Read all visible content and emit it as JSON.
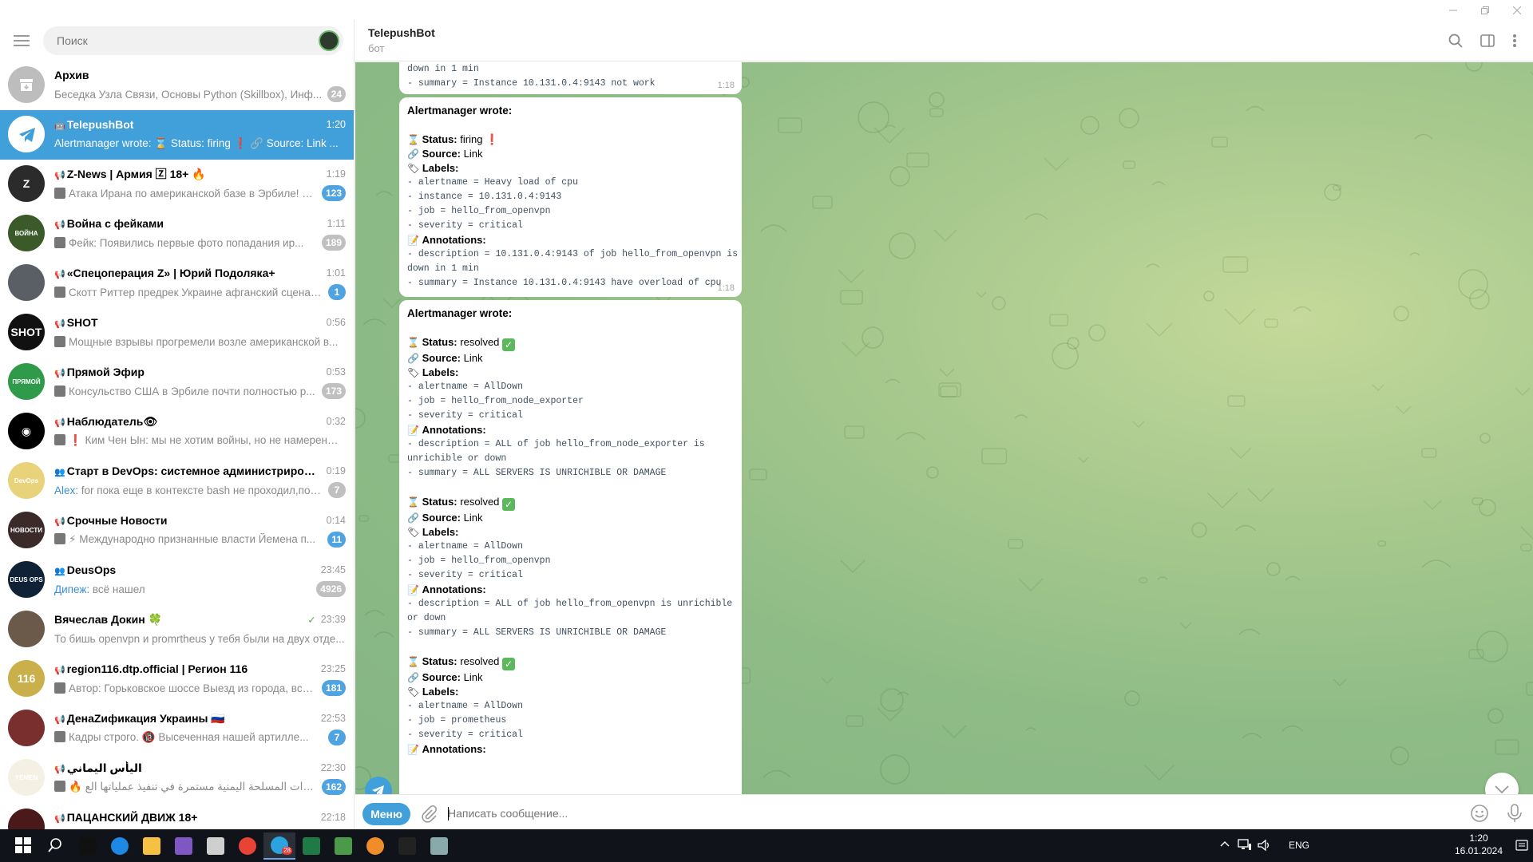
{
  "window": {
    "controls": [
      "minimize",
      "restore",
      "close"
    ]
  },
  "sidebar": {
    "search_placeholder": "Поиск",
    "chats": [
      {
        "title": "Архив",
        "preview": "Беседка Узла Связи, Основы Python (Skillbox), Инф...",
        "time": "",
        "badge": "24",
        "muted": true,
        "avatar_color": "#bdbdbd",
        "avatar_text": ""
      },
      {
        "title": "TelepushBot",
        "preview": "Alertmanager wrote: ⌛ Status: firing ❗ 🔗 Source: Link ...",
        "time": "1:20",
        "badge": "",
        "muted": false,
        "avatar_color": "#ffffff",
        "avatar_text": ""
      },
      {
        "title": "Z-News | Армия 🅉 18+ 🔥",
        "preview": "Атака Ирана по американской базе в Эрбиле! С...",
        "time": "1:19",
        "badge": "123",
        "muted": false,
        "avatar_color": "#2b2b2b",
        "avatar_text": "Z"
      },
      {
        "title": "Война с фейками",
        "preview": "Фейк: Появились первые фото попадания ир...",
        "time": "1:11",
        "badge": "189",
        "muted": true,
        "avatar_color": "#3a5a2a",
        "avatar_text": "ВОЙНА"
      },
      {
        "title": "«Спецоперация Z» | Юрий Подоляка+",
        "preview": "Скотт Риттер предрек Украине афганский сценар...",
        "time": "1:01",
        "badge": "1",
        "muted": false,
        "avatar_color": "#5a5f66",
        "avatar_text": ""
      },
      {
        "title": "SHOT",
        "preview": "Мощные взрывы прогремели возле американской в...",
        "time": "0:56",
        "badge": "",
        "muted": false,
        "avatar_color": "#111111",
        "avatar_text": "SHOT"
      },
      {
        "title": "Прямой Эфир",
        "preview": "Консульство США в Эрбиле почти полностью р...",
        "time": "0:53",
        "badge": "173",
        "muted": true,
        "avatar_color": "#2f9a4a",
        "avatar_text": "ПРЯМОЙ"
      },
      {
        "title": "Наблюдатель👁",
        "preview": "❗ Ким Чен Ын: мы не хотим войны, но не намерены ...",
        "time": "0:32",
        "badge": "",
        "muted": false,
        "avatar_color": "#000000",
        "avatar_text": "◉"
      },
      {
        "title": "Старт в DevOps: системное администрирован...",
        "preview": "for пока еще в контексте bash не проходил,пом...",
        "sender": "Alex:",
        "time": "0:19",
        "badge": "7",
        "muted": true,
        "avatar_color": "#e8d27a",
        "avatar_text": "DevOps"
      },
      {
        "title": "Срочные Новости",
        "preview": "⚡ Международно признанные власти Йемена п...",
        "time": "0:14",
        "badge": "11",
        "muted": false,
        "avatar_color": "#3b2a2a",
        "avatar_text": "НОВОСТИ"
      },
      {
        "title": "DeusOps",
        "preview": "всё нашел",
        "sender": "Дипеж:",
        "time": "23:45",
        "badge": "4926",
        "muted": true,
        "avatar_color": "#0f2236",
        "avatar_text": "DEUS OPS"
      },
      {
        "title": "Вячеслав Докин 🍀",
        "preview": "То бишь openvpn и promrtheus у тебя были на двух отде...",
        "time": "23:39",
        "badge": "",
        "muted": false,
        "read": "✓",
        "avatar_color": "#6b5a4a",
        "avatar_text": ""
      },
      {
        "title": "region116.dtp.official | Регион 116",
        "preview": "Автор: Горьковское шоссе  Выезд из города, все...",
        "time": "23:25",
        "badge": "181",
        "muted": false,
        "avatar_color": "#c9b04a",
        "avatar_text": "116"
      },
      {
        "title": "ДенаZификация Украины 🇷🇺",
        "preview": "Кадры строго. 🔞 Высеченная нашей артилле...",
        "time": "22:53",
        "badge": "7",
        "muted": false,
        "avatar_color": "#7a2f2f",
        "avatar_text": ""
      },
      {
        "title": "اليأس اليماني",
        "preview": "🔥 القوات المسلحة اليمنية مستمرة في تنفيذ عملياتها الع...",
        "time": "22:30",
        "badge": "162",
        "muted": false,
        "avatar_color": "#f4f0e4",
        "avatar_text": "YEMEN"
      },
      {
        "title": "ПАЦАНСКИЙ ДВИЖ 18+",
        "preview": "",
        "time": "22:18",
        "badge": "",
        "muted": false,
        "avatar_color": "#4a1a1a",
        "avatar_text": ""
      }
    ]
  },
  "chat": {
    "title": "TelepushBot",
    "status": "бот",
    "composer": {
      "menu_label": "Меню",
      "placeholder": "Написать сообщение..."
    },
    "messages": [
      {
        "time": "1:18",
        "lines_top": [
          {
            "text": "down in 1 min",
            "kind": "cont"
          },
          {
            "key": "summary",
            "value": "Instance 10.131.0.4:9143 not work"
          }
        ]
      },
      {
        "time": "1:18",
        "header": "Alertmanager wrote:",
        "blocks": [
          {
            "status_label": "Status:",
            "status_value": "firing",
            "status_mark": "❗",
            "source_label": "Source:",
            "source_value": "Link",
            "labels_label": "Labels:",
            "labels": [
              {
                "key": "alertname",
                "value": "Heavy load of cpu"
              },
              {
                "key": "instance",
                "value": "10.131.0.4:9143"
              },
              {
                "key": "job",
                "value": "hello_from_openvpn"
              },
              {
                "key": "severity",
                "value": "critical"
              }
            ],
            "annotations_label": "Annotations:",
            "annotations": [
              {
                "key": "description",
                "value": "10.131.0.4:9143 of job hello_from_openvpn is",
                "cont": "down in 1 min"
              },
              {
                "key": "summary",
                "value": "Instance 10.131.0.4:9143  have overload of cpu"
              }
            ]
          }
        ]
      },
      {
        "time": "",
        "header": "Alertmanager wrote:",
        "blocks": [
          {
            "status_label": "Status:",
            "status_value": "resolved",
            "status_mark": "✓",
            "source_label": "Source:",
            "source_value": "Link",
            "labels_label": "Labels:",
            "labels": [
              {
                "key": "alertname",
                "value": "AllDown"
              },
              {
                "key": "job",
                "value": "hello_from_node_exporter"
              },
              {
                "key": "severity",
                "value": "critical"
              }
            ],
            "annotations_label": "Annotations:",
            "annotations": [
              {
                "key": "description",
                "value": "ALL  of job hello_from_node_exporter is",
                "cont": "unrichible or down"
              },
              {
                "key": "summary",
                "value": "ALL SERVERS IS UNRICHIBLE OR DAMAGE"
              }
            ]
          },
          {
            "status_label": "Status:",
            "status_value": "resolved",
            "status_mark": "✓",
            "source_label": "Source:",
            "source_value": "Link",
            "labels_label": "Labels:",
            "labels": [
              {
                "key": "alertname",
                "value": "AllDown"
              },
              {
                "key": "job",
                "value": "hello_from_openvpn"
              },
              {
                "key": "severity",
                "value": "critical"
              }
            ],
            "annotations_label": "Annotations:",
            "annotations": [
              {
                "key": "description",
                "value": "ALL  of job hello_from_openvpn is unrichible",
                "cont": "or down"
              },
              {
                "key": "summary",
                "value": "ALL SERVERS IS UNRICHIBLE OR DAMAGE"
              }
            ]
          },
          {
            "status_label": "Status:",
            "status_value": "resolved",
            "status_mark": "✓",
            "source_label": "Source:",
            "source_value": "Link",
            "labels_label": "Labels:",
            "labels": [
              {
                "key": "alertname",
                "value": "AllDown"
              },
              {
                "key": "job",
                "value": "prometheus"
              },
              {
                "key": "severity",
                "value": "critical"
              }
            ],
            "annotations_label": "Annotations:",
            "annotations": []
          }
        ]
      }
    ]
  },
  "taskbar": {
    "apps": [
      "windows-start",
      "search",
      "tiktok",
      "edge",
      "file-explorer",
      "photos",
      "3d-viewer",
      "chrome",
      "telegram",
      "excel",
      "task-manager",
      "app-orange",
      "terminal",
      "app-misc"
    ],
    "telegram_badge": "28",
    "tray": {
      "lang": "ENG",
      "time": "1:20",
      "date": "16.01.2024"
    }
  },
  "colors": {
    "accent": "#419fd9",
    "chat_bg": "#a8c98e",
    "taskbar": "#101319",
    "badge": "#4fa3e0",
    "badge_muted": "#c0c0c0"
  }
}
